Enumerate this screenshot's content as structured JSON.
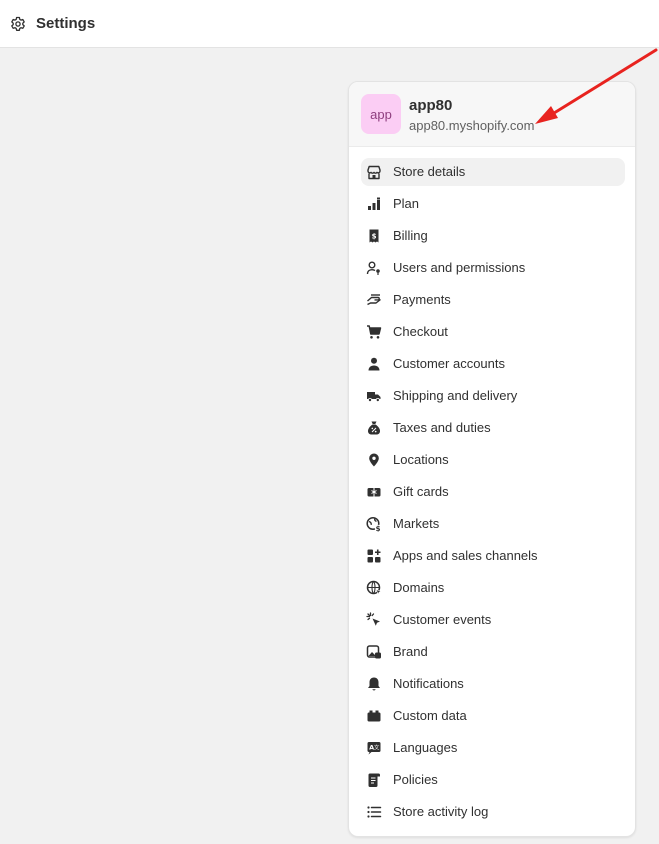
{
  "header": {
    "title": "Settings",
    "icon": "gear-icon"
  },
  "store": {
    "avatar_text": "app",
    "name": "app80",
    "domain": "app80.myshopify.com",
    "avatar_color": "#fbcdf4"
  },
  "nav": {
    "active_index": 0,
    "items": [
      {
        "label": "Store details",
        "icon": "store-icon"
      },
      {
        "label": "Plan",
        "icon": "plan-icon"
      },
      {
        "label": "Billing",
        "icon": "billing-icon"
      },
      {
        "label": "Users and permissions",
        "icon": "users-icon"
      },
      {
        "label": "Payments",
        "icon": "payments-icon"
      },
      {
        "label": "Checkout",
        "icon": "cart-icon"
      },
      {
        "label": "Customer accounts",
        "icon": "person-icon"
      },
      {
        "label": "Shipping and delivery",
        "icon": "truck-icon"
      },
      {
        "label": "Taxes and duties",
        "icon": "tax-icon"
      },
      {
        "label": "Locations",
        "icon": "location-pin-icon"
      },
      {
        "label": "Gift cards",
        "icon": "gift-card-icon"
      },
      {
        "label": "Markets",
        "icon": "globe-dollar-icon"
      },
      {
        "label": "Apps and sales channels",
        "icon": "apps-icon"
      },
      {
        "label": "Domains",
        "icon": "globe-icon"
      },
      {
        "label": "Customer events",
        "icon": "cursor-click-icon"
      },
      {
        "label": "Brand",
        "icon": "brand-image-icon"
      },
      {
        "label": "Notifications",
        "icon": "bell-icon"
      },
      {
        "label": "Custom data",
        "icon": "custom-data-icon"
      },
      {
        "label": "Languages",
        "icon": "language-icon"
      },
      {
        "label": "Policies",
        "icon": "policy-icon"
      },
      {
        "label": "Store activity log",
        "icon": "list-icon"
      }
    ]
  },
  "annotation": {
    "arrow_color": "#e8231f"
  }
}
